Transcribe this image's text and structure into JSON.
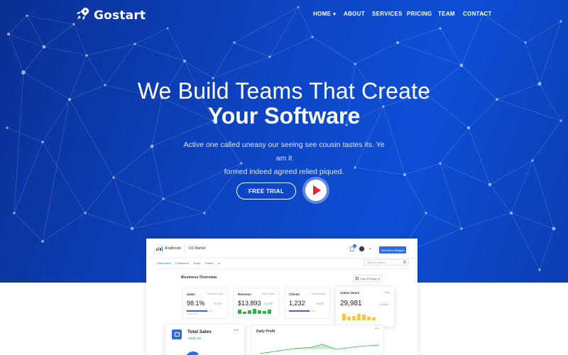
{
  "brand": {
    "name": "Gostart"
  },
  "nav": {
    "items": [
      {
        "label": "HOME",
        "has_dropdown": true
      },
      {
        "label": "ABOUT"
      },
      {
        "label": "SERVICES"
      },
      {
        "label": "PRICING"
      },
      {
        "label": "TEAM"
      },
      {
        "label": "CONTACT"
      }
    ]
  },
  "hero": {
    "title_line1": "We Build Teams That Create",
    "title_line2": "Your Software",
    "subtitle_line1": "Active one called uneasy our seeing see cousin tastes its. Ye am it",
    "subtitle_line2": "formed indeed agreed relied piqued.",
    "cta_label": "FREE TRIAL"
  },
  "colors": {
    "hero_bg": "#0d45c4",
    "accent": "#2f6bdc",
    "play_red": "#e6213a",
    "positive": "#2db34a",
    "yellow": "#f5c842"
  },
  "dashboard": {
    "brand": "Analiticalic",
    "market": "US Market",
    "add_button": "Add More Widgets",
    "notification_count": "3",
    "tabs": [
      "Dashboard",
      "Customers",
      "Goals",
      "Orders",
      "•••"
    ],
    "search_placeholder": "Type to search...",
    "section_title": "Business Overview",
    "date_filter": "Last 30 Days",
    "cards": {
      "sales": {
        "title": "Sales",
        "subtitle": "Monthly Goal",
        "value": "98.1%",
        "change": "+6.7%",
        "foot": "Yearly Goal",
        "progress": 0.75
      },
      "revenue": {
        "title": "Revenue",
        "subtitle": "Total Profit",
        "value": "$13,893",
        "change": "+11.3%"
      },
      "clients": {
        "title": "Clients",
        "subtitle": "Subscribed",
        "value": "1,232",
        "change": "+8.2%",
        "progress": 0.75
      },
      "active_users": {
        "title": "Active Users",
        "subtitle": "Total",
        "value": "29,981",
        "change": "+12.4%"
      }
    },
    "total_sales": {
      "title": "Total Sales",
      "value": "+$985.36",
      "more": "•••"
    },
    "daily_profit": {
      "title": "Daily Profit",
      "more": "•••"
    }
  }
}
